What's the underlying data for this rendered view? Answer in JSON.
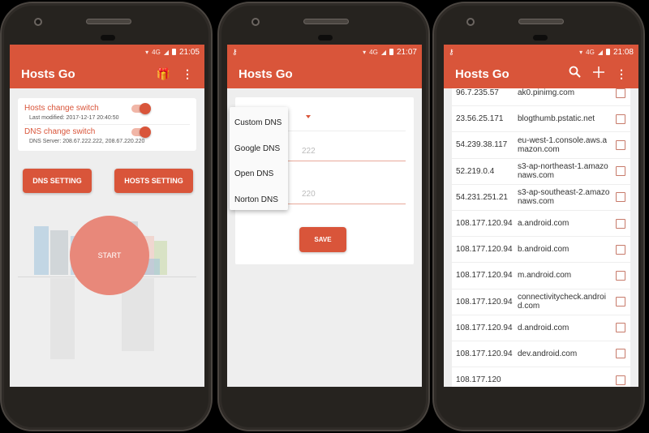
{
  "app": {
    "title": "Hosts Go",
    "accent_color": "#d9553a"
  },
  "screens": [
    {
      "status": {
        "time": "21:05",
        "left_icon": ""
      },
      "appbar_icons": [
        "gift-icon",
        "more-vert-icon"
      ],
      "switches": [
        {
          "label": "Hosts change switch",
          "sub": "Last modified:  2017-12-17 20:40:50",
          "on": true
        },
        {
          "label": "DNS change switch",
          "sub": "DNS Server:  208.67.222.222,  208.67.220.220",
          "on": true
        }
      ],
      "buttons": {
        "dns": "DNS SETTING",
        "hosts": "HOSTS SETTING"
      },
      "start_label": "START"
    },
    {
      "status": {
        "time": "21:07",
        "left_icon": "key-icon"
      },
      "fields": [
        {
          "value_partial": "222"
        },
        {
          "value_partial": "220"
        }
      ],
      "dropdown_options": [
        "Custom DNS",
        "Google DNS",
        "Open DNS",
        "Norton DNS"
      ],
      "save_label": "SAVE"
    },
    {
      "status": {
        "time": "21:08",
        "left_icon": "key-icon"
      },
      "appbar_icons": [
        "search-icon",
        "add-icon",
        "more-vert-icon"
      ],
      "hosts": [
        {
          "ip": "96.7.235.57",
          "host": "ak0.pinimg.com"
        },
        {
          "ip": "23.56.25.171",
          "host": "blogthumb.pstatic.net"
        },
        {
          "ip": "54.239.38.117",
          "host": "eu-west-1.console.aws.amazon.com"
        },
        {
          "ip": "52.219.0.4",
          "host": "s3-ap-northeast-1.amazonaws.com"
        },
        {
          "ip": "54.231.251.21",
          "host": "s3-ap-southeast-2.amazonaws.com"
        },
        {
          "ip": "108.177.120.94",
          "host": "a.android.com"
        },
        {
          "ip": "108.177.120.94",
          "host": "b.android.com"
        },
        {
          "ip": "108.177.120.94",
          "host": "m.android.com"
        },
        {
          "ip": "108.177.120.94",
          "host": "connectivitycheck.android.com"
        },
        {
          "ip": "108.177.120.94",
          "host": "d.android.com"
        },
        {
          "ip": "108.177.120.94",
          "host": "dev.android.com"
        },
        {
          "ip": "108.177.120",
          "host": ""
        }
      ]
    }
  ]
}
